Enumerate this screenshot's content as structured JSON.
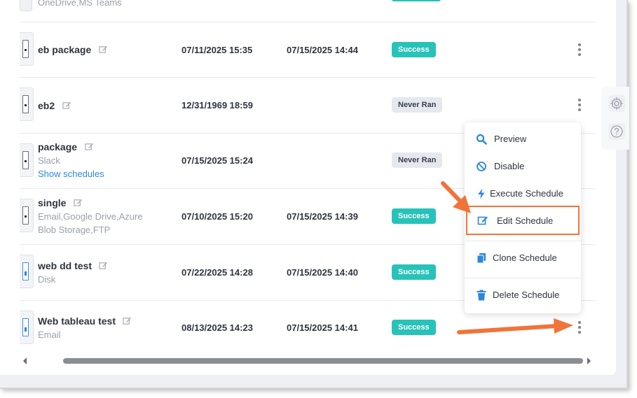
{
  "rows": [
    {
      "name": "OneDrive,MS Teams"
    },
    {
      "name": "eb package",
      "created": "07/11/2025 15:35",
      "last_run": "07/15/2025 14:44",
      "status": "Success"
    },
    {
      "name": "eb2",
      "created": "12/31/1969 18:59",
      "last_run": "",
      "status": "Never Ran"
    },
    {
      "name": "package",
      "sub": "Slack",
      "link": "Show schedules",
      "created": "07/15/2025 15:24",
      "last_run": "",
      "status": "Never Ran"
    },
    {
      "name": "single",
      "sub1": "Email,Google Drive,Azure",
      "sub2": "Blob Storage,FTP",
      "created": "07/10/2025 15:20",
      "last_run": "07/15/2025 14:39",
      "status": "Success"
    },
    {
      "name": "web dd test",
      "sub": "Disk",
      "created": "07/22/2025 14:28",
      "last_run": "07/15/2025 14:40",
      "status": "Success"
    },
    {
      "name": "Web tableau test",
      "sub": "Email",
      "created": "08/13/2025 14:23",
      "last_run": "07/15/2025 14:41",
      "status": "Success"
    }
  ],
  "menu": {
    "preview": "Preview",
    "disable": "Disable",
    "execute": "Execute Schedule",
    "edit": "Edit Schedule",
    "clone": "Clone Schedule",
    "delete": "Delete Schedule"
  },
  "colors": {
    "accent_blue": "#2a88db",
    "success": "#27c2b8",
    "annotation_orange": "#f0743a"
  }
}
